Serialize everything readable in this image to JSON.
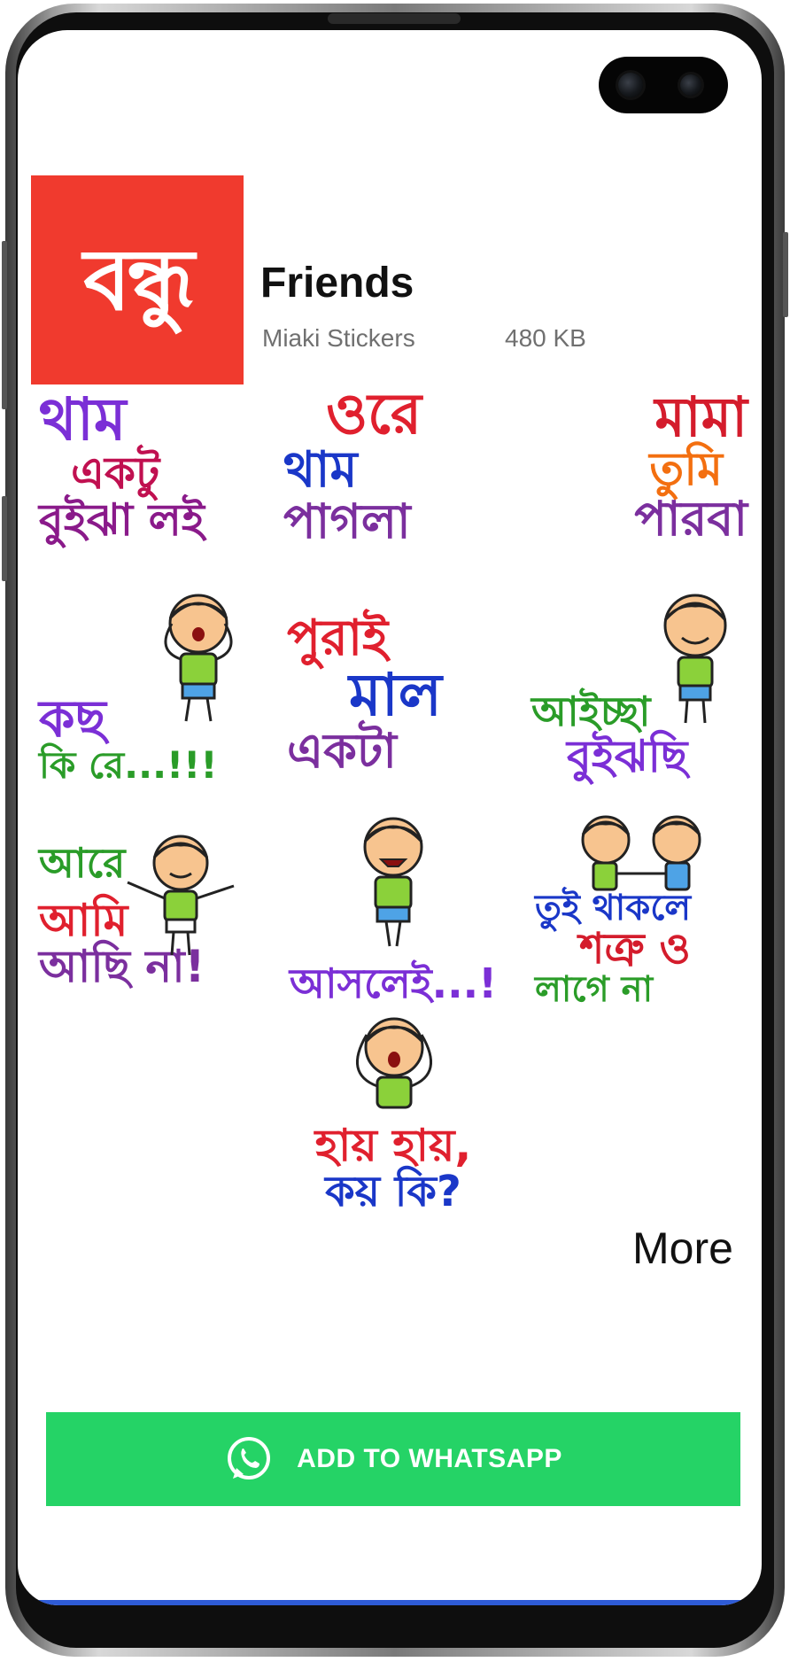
{
  "pack": {
    "icon_text": "বন্ধু",
    "title": "Friends",
    "publisher": "Miaki Stickers",
    "size": "480 KB"
  },
  "stickers": [
    {
      "lines": [
        "থাম",
        "একটু",
        "বুইঝা লই"
      ],
      "colors": [
        "#7b2fd6",
        "#c01050",
        "#8a1a8a"
      ]
    },
    {
      "lines": [
        "ওরে",
        "থাম",
        "পাগলা"
      ],
      "colors": [
        "#e0202e",
        "#1a37c8",
        "#7b2f9e"
      ]
    },
    {
      "lines": [
        "মামা",
        "তুমি",
        "পারবা"
      ],
      "colors": [
        "#d41c2c",
        "#f36f10",
        "#7b2f9e"
      ]
    },
    {
      "lines": [
        "কছ",
        "কি রে...!!!"
      ],
      "colors": [
        "#7b2fd6",
        "#2a9c28"
      ]
    },
    {
      "lines": [
        "পুরাই",
        "মাল",
        "একটা"
      ],
      "colors": [
        "#e0202e",
        "#1a37c8",
        "#7b2f9e"
      ]
    },
    {
      "lines": [
        "আইচ্ছা",
        "বুইঝছি"
      ],
      "colors": [
        "#2a9c28",
        "#7b2fd6"
      ]
    },
    {
      "lines": [
        "আরে",
        "আমি",
        "আছি না!"
      ],
      "colors": [
        "#2a9c28",
        "#e0202e",
        "#7b2f9e"
      ]
    },
    {
      "lines": [
        "আসলেই...!"
      ],
      "colors": [
        "#7b2fd6"
      ]
    },
    {
      "lines": [
        "তুই থাকলে",
        "শত্রু ও",
        "লাগে না"
      ],
      "colors": [
        "#1a37c8",
        "#d41c2c",
        "#2a9c28"
      ]
    },
    {
      "lines": [
        "হায় হায়,",
        "কয় কি?"
      ],
      "colors": [
        "#e0202e",
        "#1a37c8"
      ]
    }
  ],
  "more_label": "More",
  "add_button": {
    "label": "ADD TO WHATSAPP",
    "color": "#25d366"
  },
  "icons": {
    "add_button_icon": "whatsapp-icon"
  }
}
